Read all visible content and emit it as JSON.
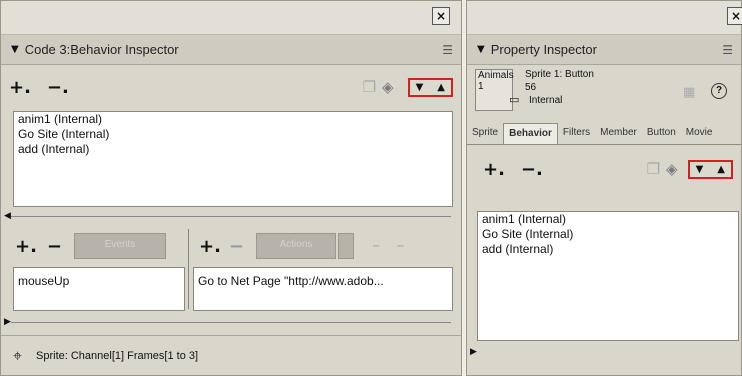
{
  "left": {
    "panel_title": "Code 3:Behavior Inspector",
    "behaviors": [
      "anim1 (Internal)",
      "Go Site (Internal)",
      "add (Internal)"
    ],
    "event_placeholder": "Events",
    "action_placeholder": "Actions",
    "event_value": "mouseUp",
    "action_value": "Go to Net Page \"http://www.adob...",
    "status": "Sprite:  Channel[1]  Frames[1 to 3]"
  },
  "right": {
    "panel_title": "Property Inspector",
    "cast_name": "Animals",
    "cast_number": "1",
    "sprite_label": "Sprite 1: Button",
    "sprite_number": "56",
    "sprite_source": "Internal",
    "tabs": [
      "Sprite",
      "Behavior",
      "Filters",
      "Member",
      "Button",
      "Movie"
    ],
    "behaviors": [
      "anim1 (Internal)",
      "Go Site (Internal)",
      "add (Internal)"
    ]
  }
}
